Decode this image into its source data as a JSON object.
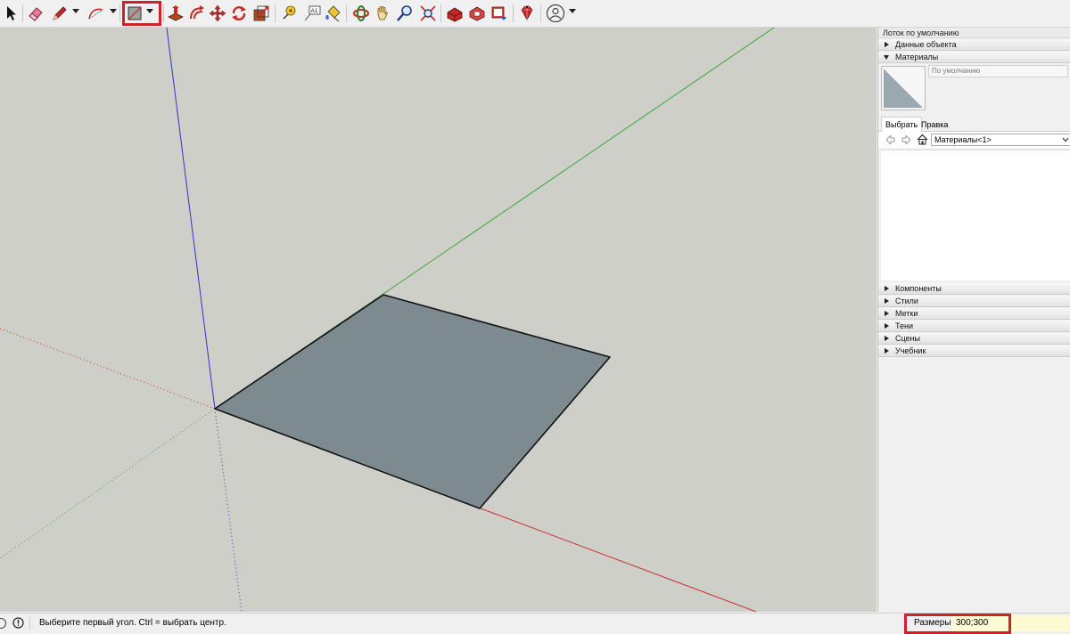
{
  "toolbar": {
    "tools": [
      {
        "name": "select-tool",
        "icon": "arrow-cursor-icon"
      },
      {
        "name": "eraser-tool",
        "icon": "eraser-icon"
      },
      {
        "name": "line-tool",
        "icon": "pencil-icon",
        "has_dropdown": true
      },
      {
        "name": "arc-tool",
        "icon": "arc-icon",
        "has_dropdown": true
      },
      {
        "name": "rectangle-tool",
        "icon": "rectangle-icon",
        "has_dropdown": true,
        "highlighted": true
      },
      {
        "name": "push-pull-tool",
        "icon": "push-pull-icon"
      },
      {
        "name": "offset-tool",
        "icon": "offset-icon"
      },
      {
        "name": "move-tool",
        "icon": "move-icon"
      },
      {
        "name": "rotate-tool",
        "icon": "rotate-icon"
      },
      {
        "name": "scale-tool",
        "icon": "scale-icon"
      },
      {
        "name": "tape-measure-tool",
        "icon": "tape-measure-icon"
      },
      {
        "name": "text-tool",
        "icon": "text-icon"
      },
      {
        "name": "paint-bucket-tool",
        "icon": "paint-bucket-icon"
      },
      {
        "name": "orbit-tool",
        "icon": "orbit-icon"
      },
      {
        "name": "pan-tool",
        "icon": "hand-icon"
      },
      {
        "name": "zoom-tool",
        "icon": "magnifier-icon"
      },
      {
        "name": "zoom-extents-tool",
        "icon": "zoom-extents-icon"
      },
      {
        "name": "warehouse-tool",
        "icon": "warehouse-icon"
      },
      {
        "name": "extension-warehouse-tool",
        "icon": "extension-warehouse-icon"
      },
      {
        "name": "send-to-layout-tool",
        "icon": "layout-icon"
      },
      {
        "name": "extension-manager-tool",
        "icon": "ruby-gem-icon"
      },
      {
        "name": "account-button",
        "icon": "user-avatar-icon",
        "has_dropdown": true
      }
    ],
    "text_tool_glyph": "A1"
  },
  "tray": {
    "title": "Лоток по умолчанию",
    "entity_info": "Данные объекта",
    "materials": {
      "header": "Материалы",
      "material_name": "По умолчанию",
      "tabs": [
        "Выбрать",
        "Правка"
      ],
      "collection": "Материалы<1>"
    },
    "collapsed": [
      "Компоненты",
      "Стили",
      "Метки",
      "Тени",
      "Сцены",
      "Учебник"
    ]
  },
  "status": {
    "hint": "Выберите первый угол. Ctrl = выбрать центр.",
    "measurements_label": "Размеры",
    "measurements_value": "300;300"
  },
  "colors": {
    "highlight": "#d0202a",
    "viewport_bg": "#cfcfca",
    "face_fill": "#7d8a8f",
    "axis_red": "#c8302c",
    "axis_green": "#36a836",
    "axis_blue": "#3232c8",
    "vcb_bg": "#fdfbd3"
  }
}
